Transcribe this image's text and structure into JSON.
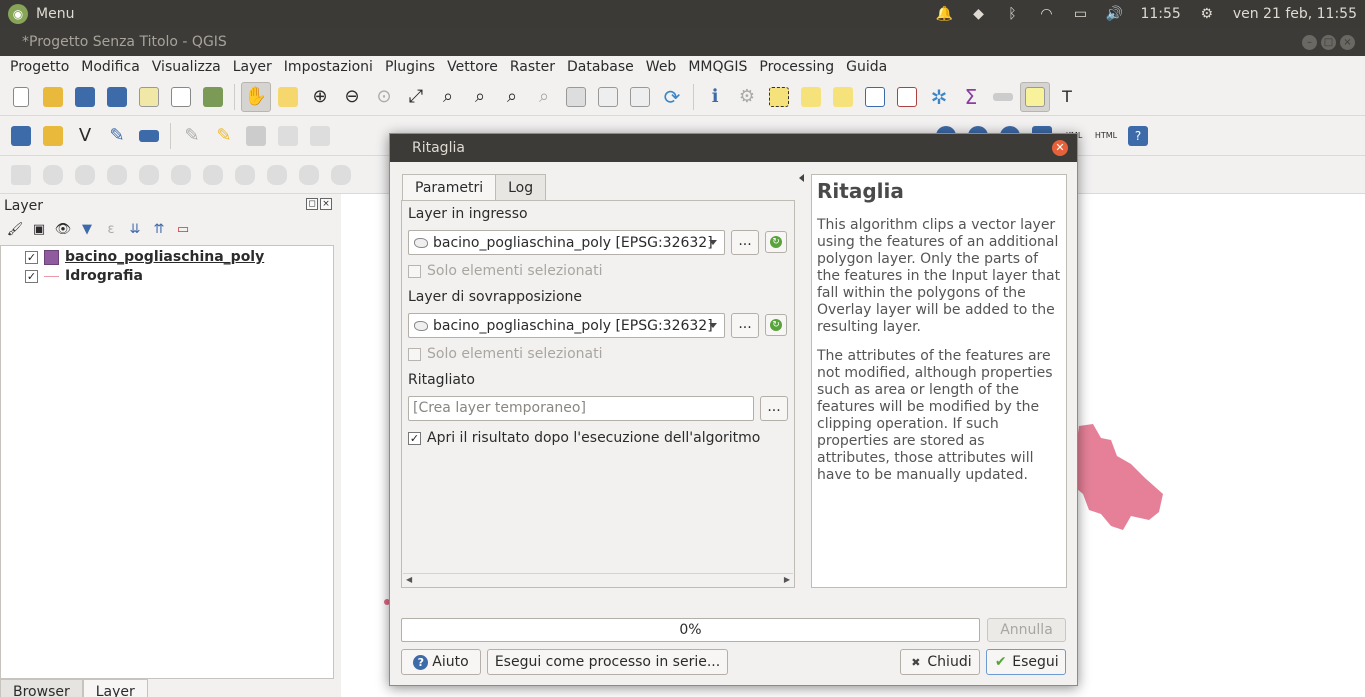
{
  "system": {
    "menu_label": "Menu",
    "time": "11:55",
    "datetime": "ven 21 feb, 11:55"
  },
  "window": {
    "title": "*Progetto Senza Titolo - QGIS"
  },
  "menubar": [
    "Progetto",
    "Modifica",
    "Visualizza",
    "Layer",
    "Impostazioni",
    "Plugins",
    "Vettore",
    "Raster",
    "Database",
    "Web",
    "MMQGIS",
    "Processing",
    "Guida"
  ],
  "layers_panel": {
    "title": "Layer",
    "layers": [
      {
        "name": "bacino_pogliaschina_poly",
        "checked": true,
        "symbol": "polygon",
        "color": "#8f5b9e"
      },
      {
        "name": "Idrografia",
        "checked": true,
        "symbol": "line",
        "color": "#e89aa6"
      }
    ],
    "bottom_tabs": [
      "Browser",
      "Layer"
    ]
  },
  "toolbar": {
    "html_label": "HTML",
    "kml_label": "KML"
  },
  "dialog": {
    "title": "Ritaglia",
    "tabs": [
      "Parametri",
      "Log"
    ],
    "input_layer": {
      "label": "Layer in ingresso",
      "value": "bacino_pogliaschina_poly [EPSG:32632]",
      "selected_only_label": "Solo elementi selezionati"
    },
    "overlay_layer": {
      "label": "Layer di sovrapposizione",
      "value": "bacino_pogliaschina_poly [EPSG:32632]",
      "selected_only_label": "Solo elementi selezionati"
    },
    "output": {
      "label": "Ritagliato",
      "placeholder": "[Crea layer temporaneo]",
      "open_after_label": "Apri il risultato dopo l'esecuzione dell'algoritmo",
      "open_after_checked": true
    },
    "browse_label": "...",
    "help": {
      "title": "Ritaglia",
      "paragraphs": [
        "This algorithm clips a vector layer using the features of an additional polygon layer. Only the parts of the features in the Input layer that fall within the polygons of the Overlay layer will be added to the resulting layer.",
        "The attributes of the features are not modified, although properties such as area or length of the features will be modified by the clipping operation. If such properties are stored as attributes, those attributes will have to be manually updated."
      ]
    },
    "progress": {
      "text": "0%",
      "value": 0
    },
    "buttons": {
      "cancel": "Annulla",
      "help": "Aiuto",
      "batch": "Esegui come processo in serie...",
      "close": "Chiudi",
      "run": "Esegui"
    }
  },
  "colors": {
    "map_feature": "#e06a86",
    "close_button": "#e6613a"
  }
}
